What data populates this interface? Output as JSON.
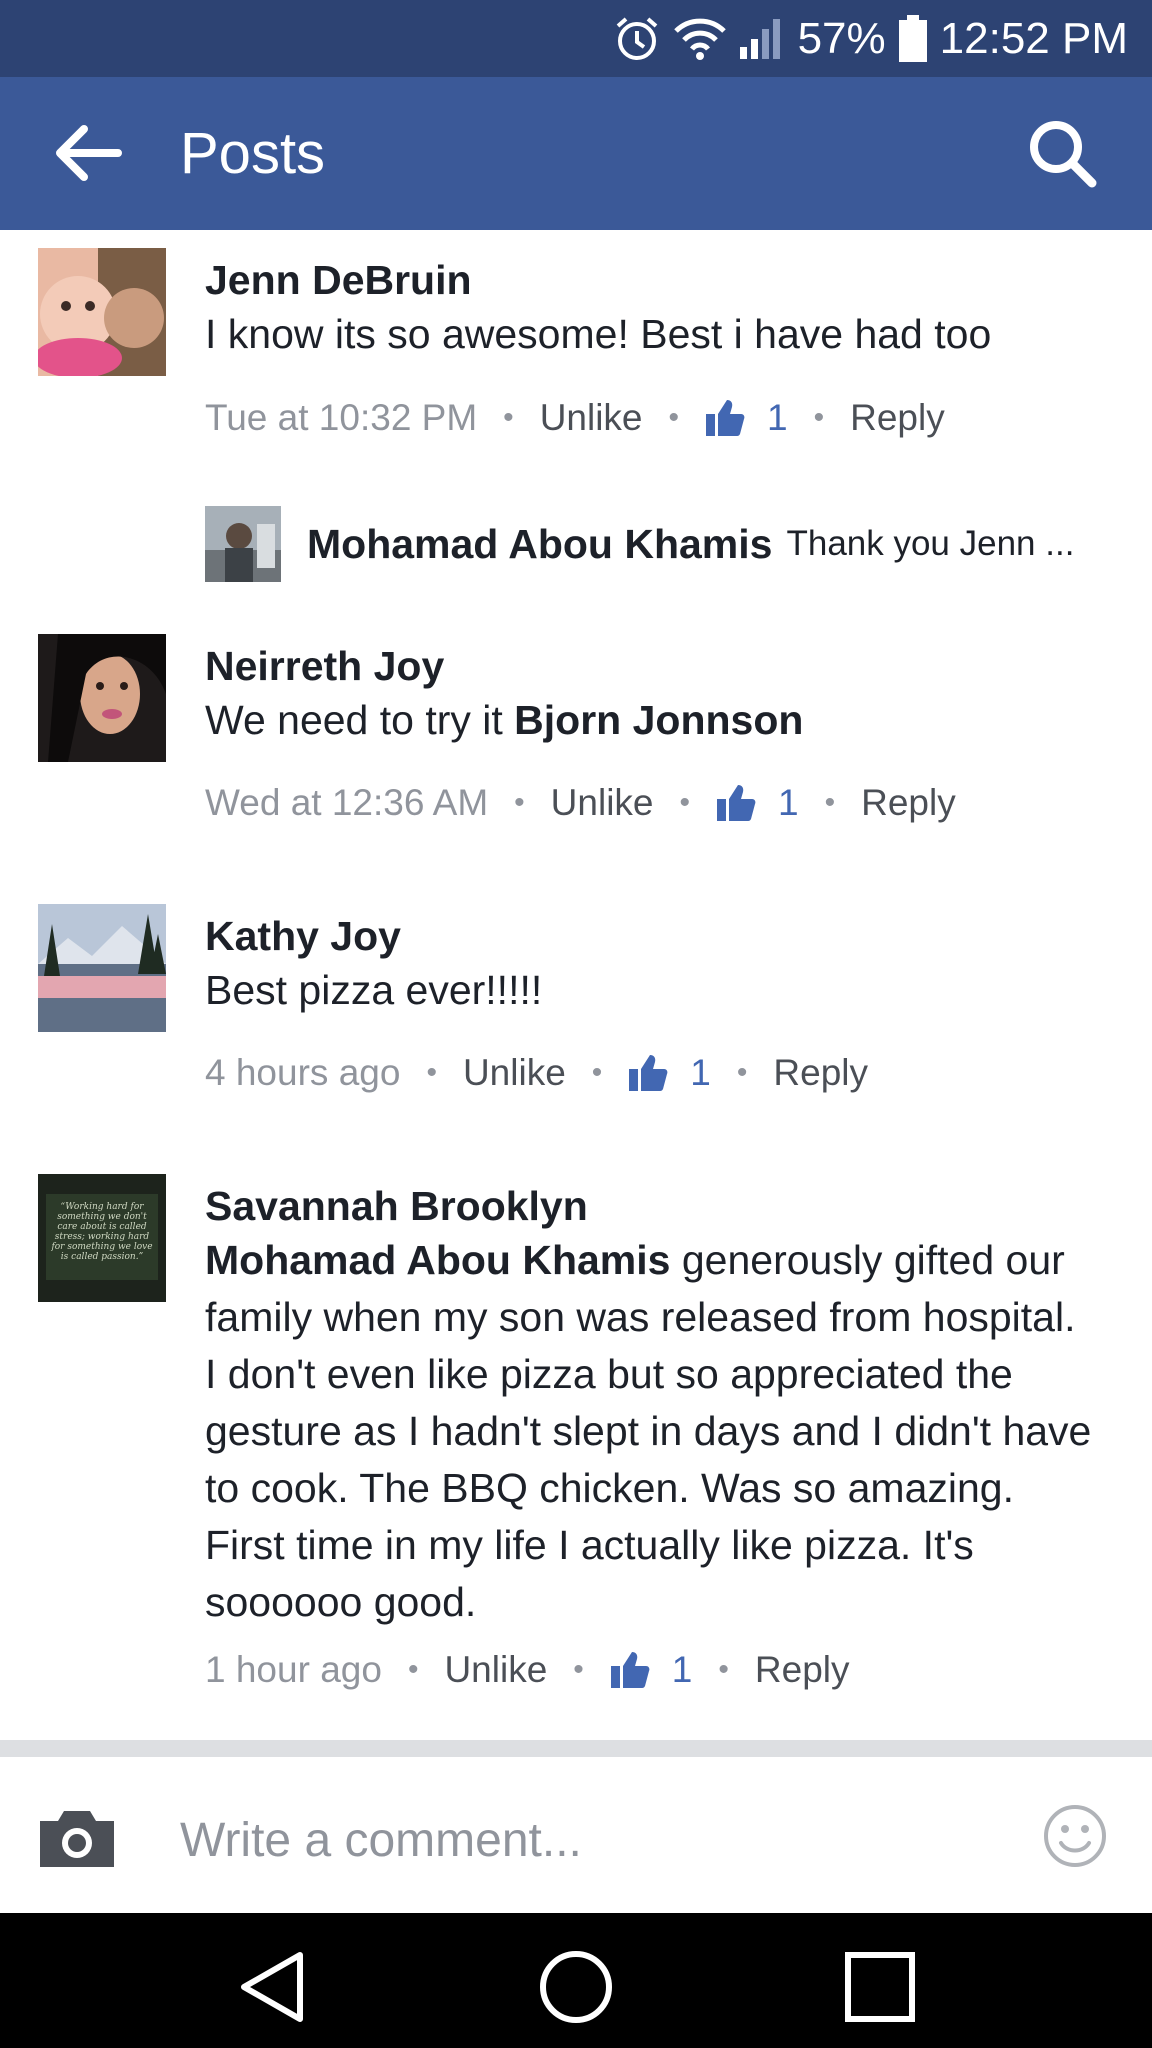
{
  "status": {
    "battery": "57%",
    "time": "12:52 PM"
  },
  "appbar": {
    "title": "Posts"
  },
  "comments": [
    {
      "name": "Jenn DeBruin",
      "text": "I know its so awesome!  Best i have had too",
      "time": "Tue at 10:32 PM",
      "unlike": "Unlike",
      "likes": "1",
      "reply": "Reply"
    },
    {
      "name": "Neirreth Joy",
      "text_prefix": "We need to try it ",
      "mention": "Bjorn Jonnson",
      "time": "Wed at 12:36 AM",
      "unlike": "Unlike",
      "likes": "1",
      "reply": "Reply"
    },
    {
      "name": "Kathy Joy",
      "text": "Best pizza ever!!!!!",
      "time": "4 hours ago",
      "unlike": "Unlike",
      "likes": "1",
      "reply": "Reply"
    },
    {
      "name": "Savannah Brooklyn",
      "mention": "Mohamad Abou Khamis",
      "text_suffix": " generously gifted our family when my son was released from hospital.  I don't even like pizza but so appreciated the gesture as I hadn't slept in days and I didn't have to cook.  The BBQ chicken. Was so amazing.  First time in my life I actually like pizza.   It's soooooo good.",
      "time": "1 hour ago",
      "unlike": "Unlike",
      "likes": "1",
      "reply": "Reply"
    }
  ],
  "reply_preview": {
    "name": "Mohamad Abou Khamis",
    "text": "Thank you Jenn ..."
  },
  "avatar_quote": "“Working hard for something we don't care about is called stress; working hard for something we love is called passion.”",
  "composer": {
    "placeholder": "Write a comment..."
  },
  "icons": {
    "back": "arrow-left-icon",
    "search": "search-icon",
    "like": "thumbs-up-icon",
    "camera": "camera-icon",
    "emoji": "smiley-icon"
  },
  "colors": {
    "header": "#3b5998",
    "status_bar": "#2d4373",
    "like_blue": "#4267b2",
    "muted": "#90949c"
  }
}
